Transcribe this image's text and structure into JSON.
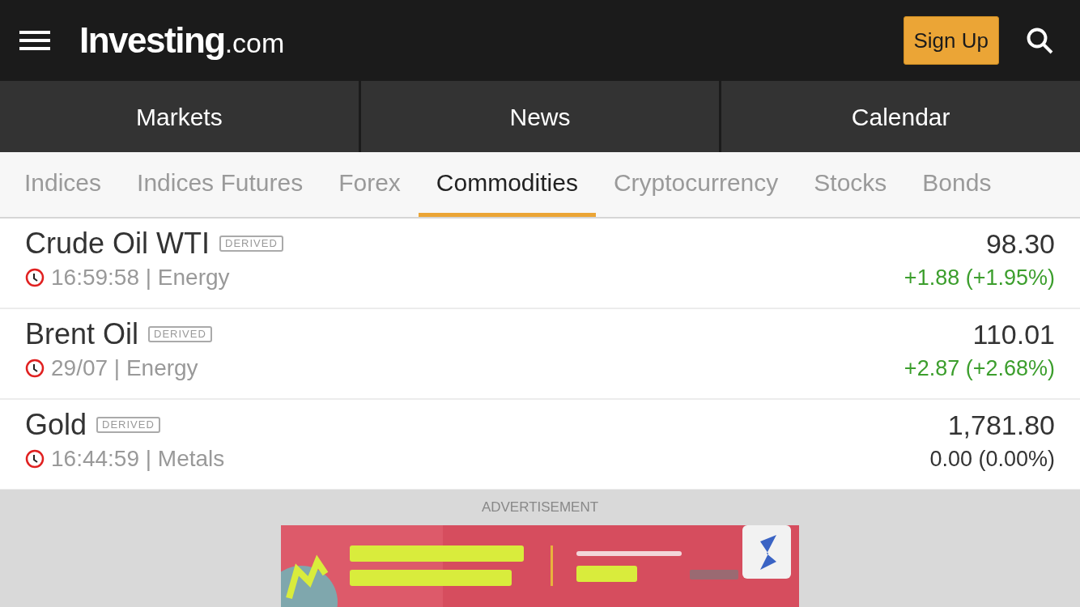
{
  "header": {
    "logo": {
      "name": "Investing",
      "suffix": ".com"
    },
    "signup_button": "Sign Up"
  },
  "main_tabs": [
    {
      "label": "Markets",
      "selected": false
    },
    {
      "label": "News",
      "selected": false
    },
    {
      "label": "Calendar",
      "selected": false
    }
  ],
  "category_tabs": [
    {
      "label": "Indices",
      "selected": false
    },
    {
      "label": "Indices Futures",
      "selected": false
    },
    {
      "label": "Forex",
      "selected": false
    },
    {
      "label": "Commodities",
      "selected": true
    },
    {
      "label": "Cryptocurrency",
      "selected": false
    },
    {
      "label": "Stocks",
      "selected": false
    },
    {
      "label": "Bonds",
      "selected": false
    }
  ],
  "rows": [
    {
      "name": "Crude Oil WTI",
      "badge": "DERIVED",
      "time": "16:59:58 | Energy",
      "price": "98.30",
      "change": "+1.88 (+1.95%)",
      "color": "#3c9e2d"
    },
    {
      "name": "Brent Oil",
      "badge": "DERIVED",
      "time": "29/07 | Energy",
      "price": "110.01",
      "change": "+2.87 (+2.68%)",
      "color": "#3c9e2d"
    },
    {
      "name": "Gold",
      "badge": "DERIVED",
      "time": "16:44:59 | Metals",
      "price": "1,781.80",
      "change": "0.00 (0.00%)",
      "color": "#333333"
    }
  ],
  "advertisement": {
    "label": "ADVERTISEMENT"
  }
}
